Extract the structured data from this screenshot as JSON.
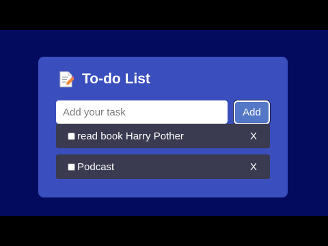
{
  "app": {
    "title": "To-do List",
    "header_icon": "memo-icon"
  },
  "input": {
    "placeholder": "Add your task",
    "value": ""
  },
  "add_button": {
    "label": "Add"
  },
  "tasks": [
    {
      "text": "read book Harry Pother",
      "checked": false,
      "delete_label": "X"
    },
    {
      "text": "Podcast",
      "checked": false,
      "delete_label": "X"
    }
  ],
  "colors": {
    "page_background": "#020b5e",
    "card_background": "#3a4fbd",
    "task_background": "#3a3a50",
    "add_button": "#5477c6"
  }
}
